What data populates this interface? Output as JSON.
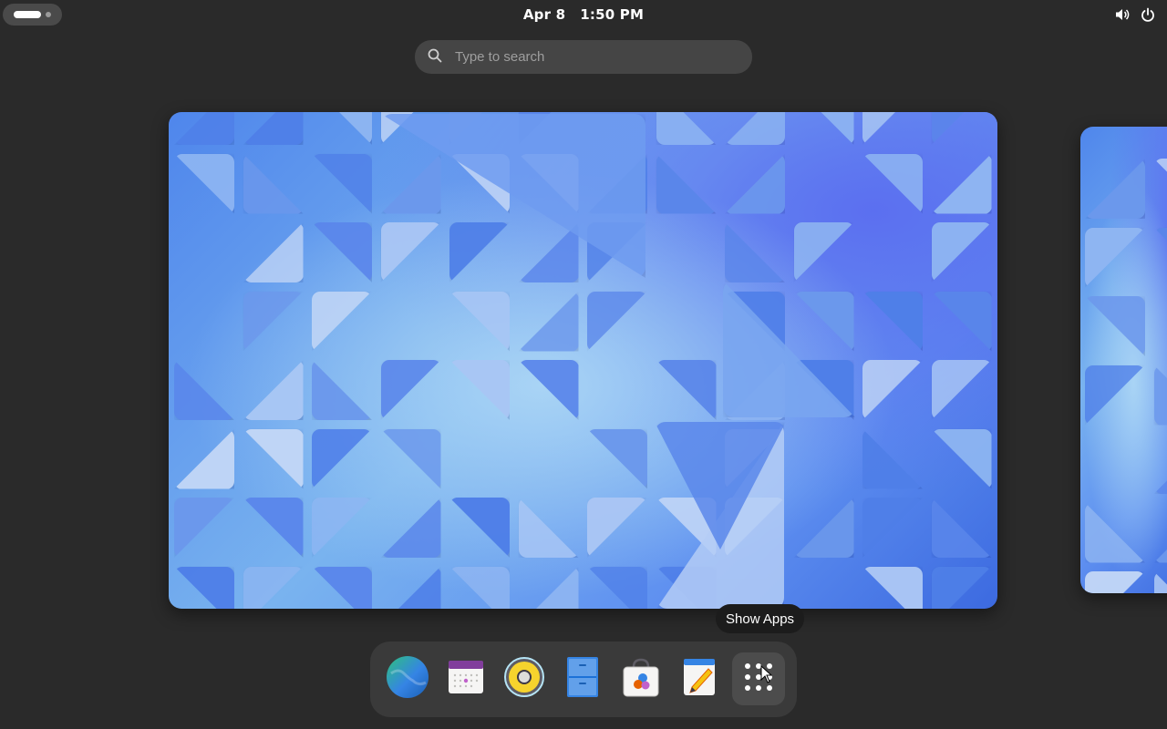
{
  "top_bar": {
    "date": "Apr 8",
    "time": "1:50 PM",
    "activities_icon": "workspace-indicator-icon",
    "tray_icons": [
      "volume-icon",
      "power-icon"
    ]
  },
  "search": {
    "placeholder": "Type to search",
    "value": "",
    "icon": "search-icon"
  },
  "workspaces": [
    {
      "label": "current-workspace",
      "wallpaper": "blue-triangles"
    },
    {
      "label": "next-workspace",
      "wallpaper": "blue-triangles"
    }
  ],
  "tooltip": {
    "text": "Show Apps"
  },
  "dock": {
    "items": [
      {
        "name": "web-browser",
        "icon": "globe-icon"
      },
      {
        "name": "calendar",
        "icon": "calendar-icon"
      },
      {
        "name": "rhythmbox",
        "icon": "speaker-icon"
      },
      {
        "name": "files",
        "icon": "file-cabinet-icon"
      },
      {
        "name": "software",
        "icon": "shopping-bag-icon"
      },
      {
        "name": "text-editor",
        "icon": "notepad-icon"
      },
      {
        "name": "show-apps",
        "icon": "app-grid-icon",
        "active": true
      }
    ]
  },
  "colors": {
    "background": "#2a2a2a",
    "dock": "#3a3a3a",
    "search": "#454545",
    "wallpaper_primary": "#4f86ec",
    "wallpaper_light": "#a9d4f5"
  }
}
